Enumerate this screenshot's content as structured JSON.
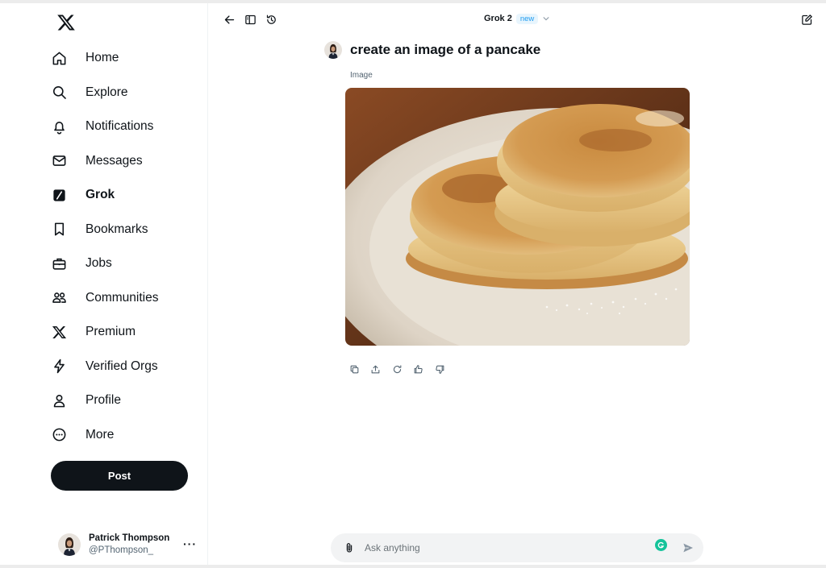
{
  "sidebar": {
    "logo": "x-logo-icon",
    "items": [
      {
        "label": "Home",
        "icon": "home-icon"
      },
      {
        "label": "Explore",
        "icon": "search-icon"
      },
      {
        "label": "Notifications",
        "icon": "bell-icon"
      },
      {
        "label": "Messages",
        "icon": "envelope-icon"
      },
      {
        "label": "Grok",
        "icon": "grok-icon",
        "active": true
      },
      {
        "label": "Bookmarks",
        "icon": "bookmark-icon"
      },
      {
        "label": "Jobs",
        "icon": "briefcase-icon"
      },
      {
        "label": "Communities",
        "icon": "people-icon"
      },
      {
        "label": "Premium",
        "icon": "x-logo-icon"
      },
      {
        "label": "Verified Orgs",
        "icon": "lightning-icon"
      },
      {
        "label": "Profile",
        "icon": "person-icon"
      },
      {
        "label": "More",
        "icon": "more-circle-icon"
      }
    ],
    "post_label": "Post"
  },
  "account": {
    "name": "Patrick Thompson",
    "handle": "@PThompson_",
    "more": "···"
  },
  "header": {
    "model_name": "Grok 2",
    "model_badge": "new"
  },
  "conversation": {
    "prompt": "create an image of a pancake",
    "image_label": "Image",
    "image_subject": "stack of pancakes on a white plate"
  },
  "composer": {
    "placeholder": "Ask anything"
  },
  "colors": {
    "accent": "#1d9bf0",
    "text": "#0f1419",
    "secondary_text": "#536471",
    "post_button": "#0f1419",
    "askbar_bg": "#f2f3f4",
    "grammarly": "#15c39a"
  }
}
